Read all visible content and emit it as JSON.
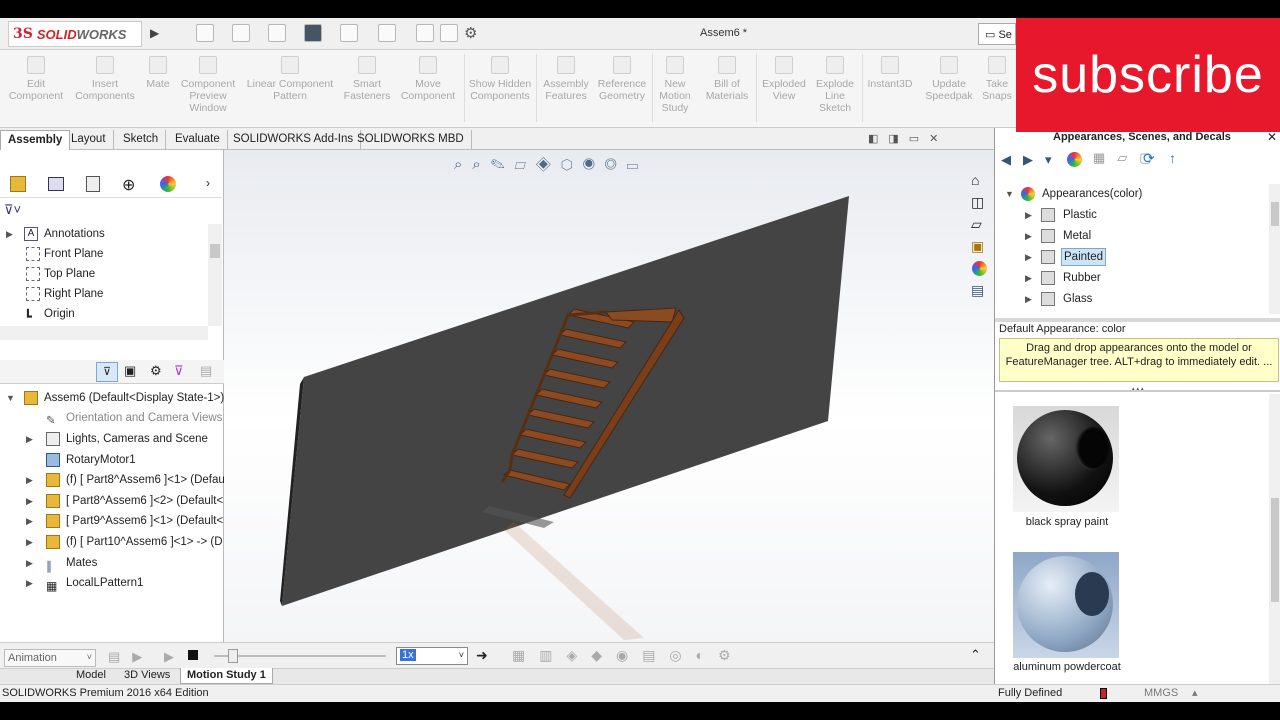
{
  "app": {
    "logo_mark": "3S",
    "logo_word_a": "SOLID",
    "logo_word_b": "WORKS",
    "document_title": "Assem6 *",
    "search_partial": "Se"
  },
  "subscribe": {
    "label": "subscribe"
  },
  "commands": [
    "Edit Component",
    "Insert Components",
    "Mate",
    "Component Preview Window",
    "Linear Component Pattern",
    "Smart Fasteners",
    "Move Component",
    "Show Hidden Components",
    "Assembly Features",
    "Reference Geometry",
    "New Motion Study",
    "Bill of Materials",
    "Exploded View",
    "Explode Line Sketch",
    "Instant3D",
    "Update Speedpak",
    "Take Snaps"
  ],
  "tabs": [
    "Assembly",
    "Layout",
    "Sketch",
    "Evaluate",
    "SOLIDWORKS Add-Ins",
    "SOLIDWORKS MBD"
  ],
  "top_tree": [
    "Annotations",
    "Front Plane",
    "Top Plane",
    "Right Plane",
    "Origin"
  ],
  "tree": {
    "root": "Assem6  (Default<Display State-1>)",
    "items": [
      "Orientation and Camera Views",
      "Lights, Cameras and Scene",
      "RotaryMotor1",
      "(f) [ Part8^Assem6 ]<1> (Defau",
      "[ Part8^Assem6 ]<2> (Default<",
      "[ Part9^Assem6 ]<1> (Default<",
      "(f) [ Part10^Assem6 ]<1> -> (D",
      "Mates",
      "LocalLPattern1"
    ]
  },
  "right_panel": {
    "title": "Appearances, Scenes, and Decals",
    "tree_root": "Appearances(color)",
    "tree_items": [
      "Plastic",
      "Metal",
      "Painted",
      "Rubber",
      "Glass"
    ],
    "selected": "Painted",
    "default_label": "Default Appearance: color",
    "tip": "Drag and drop appearances onto the model or FeatureManager tree.  ALT+drag to immediately edit. ...",
    "swatches": [
      "black spray paint",
      "aluminum powdercoat"
    ]
  },
  "motion": {
    "mode": "Animation",
    "speed": "1x"
  },
  "bottom_tabs": [
    "Model",
    "3D Views",
    "Motion Study 1"
  ],
  "status": {
    "edition": "SOLIDWORKS Premium 2016 x64 Edition",
    "state": "Fully Defined",
    "units": "MMGS"
  }
}
